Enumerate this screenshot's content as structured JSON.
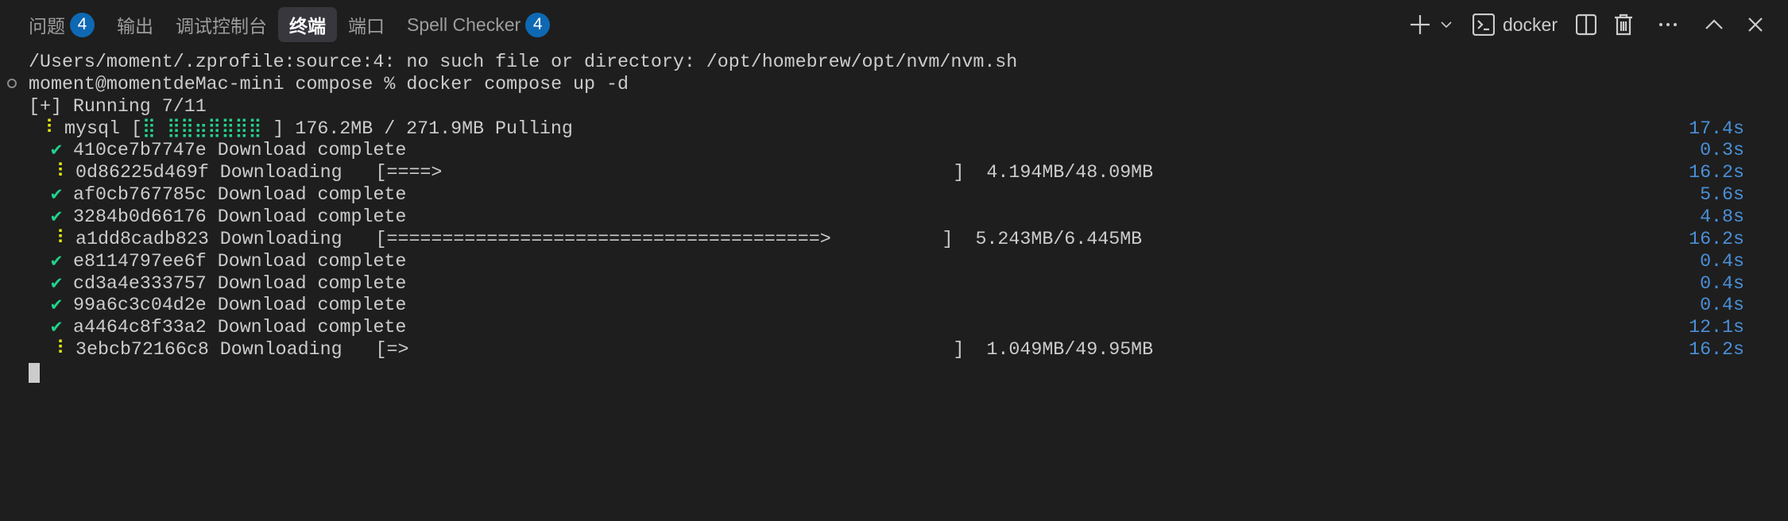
{
  "tabs": [
    {
      "label": "问题",
      "badge": "4"
    },
    {
      "label": "输出"
    },
    {
      "label": "调试控制台"
    },
    {
      "label": "终端",
      "active": true
    },
    {
      "label": "端口"
    },
    {
      "label": "Spell Checker",
      "badge": "4"
    }
  ],
  "toolbar": {
    "terminal_name": "docker",
    "icons": [
      "plus-icon",
      "chevron-down-icon",
      "terminal-icon",
      "split-icon",
      "trash-icon",
      "more-icon",
      "chevron-up-icon",
      "close-icon"
    ]
  },
  "terminal": {
    "line1": "/Users/moment/.zprofile:source:4: no such file or directory: /opt/homebrew/opt/nvm/nvm.sh",
    "prompt": "moment@momentdeMac-mini compose % docker compose up -d",
    "running": "[+] Running 7/11",
    "mysql": {
      "spinner": "⠸",
      "name": "mysql [",
      "progress": "⣿ ⣿⣿⣶⣿⣿⣿⣿",
      "rest": " ] 176.2MB / 271.9MB Pulling",
      "time": "17.4s"
    },
    "layers": [
      {
        "status": "done",
        "text": "410ce7b7747e Download complete",
        "time": "0.3s"
      },
      {
        "status": "downloading",
        "text": "0d86225d469f Downloading   [====>                                              ]  4.194MB/48.09MB",
        "time": "16.2s"
      },
      {
        "status": "done",
        "text": "af0cb767785c Download complete",
        "time": "5.6s"
      },
      {
        "status": "done",
        "text": "3284b0d66176 Download complete",
        "time": "4.8s"
      },
      {
        "status": "downloading",
        "text": "a1dd8cadb823 Downloading   [=======================================>          ]  5.243MB/6.445MB",
        "time": "16.2s"
      },
      {
        "status": "done",
        "text": "e8114797ee6f Download complete",
        "time": "0.4s"
      },
      {
        "status": "done",
        "text": "cd3a4e333757 Download complete",
        "time": "0.4s"
      },
      {
        "status": "done",
        "text": "99a6c3c04d2e Download complete",
        "time": "0.4s"
      },
      {
        "status": "done",
        "text": "a4464c8f33a2 Download complete",
        "time": "12.1s"
      },
      {
        "status": "downloading",
        "text": "3ebcb72166c8 Downloading   [=>                                                 ]  1.049MB/49.95MB",
        "time": "16.2s"
      }
    ],
    "check_glyph": "✔",
    "spinner_glyph": "⠸"
  },
  "colors": {
    "accent": "#0e68b3",
    "time": "#4a90d9",
    "success": "#23d18b",
    "spinner": "#e5e510"
  }
}
